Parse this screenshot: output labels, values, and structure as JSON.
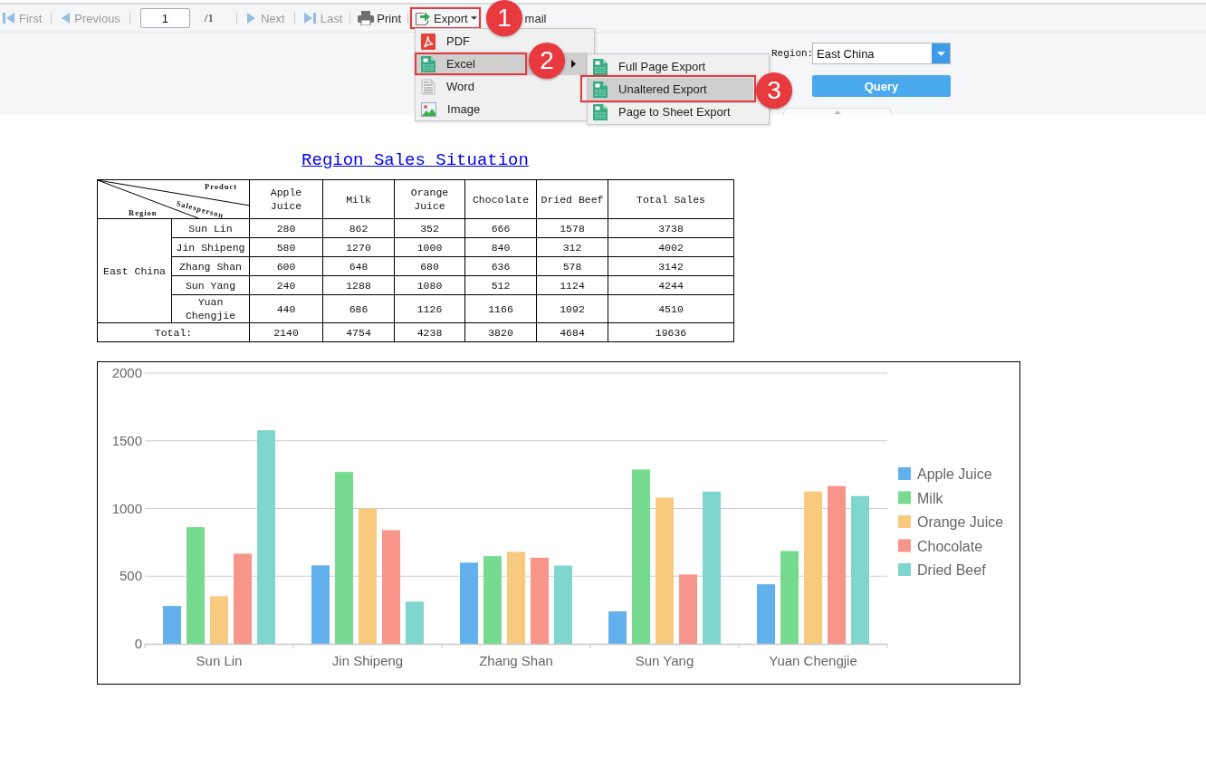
{
  "toolbar": {
    "items": [
      {
        "kind": "button",
        "label": "First",
        "disabled": true
      },
      {
        "kind": "button",
        "label": "Previous",
        "disabled": true
      },
      {
        "kind": "page",
        "value": "1",
        "total": "/1"
      },
      {
        "kind": "button",
        "label": "Next",
        "disabled": true
      },
      {
        "kind": "button",
        "label": "Last",
        "disabled": true
      },
      {
        "kind": "button",
        "label": "Print",
        "disabled": false
      },
      {
        "kind": "menu",
        "label": "Export",
        "disabled": false,
        "expanded": true,
        "callout": "1",
        "menu": {
          "items": [
            {
              "label": "PDF",
              "selected": false
            },
            {
              "label": "Excel",
              "selected": true,
              "callout": "2",
              "submenu": {
                "items": [
                  {
                    "label": "Full Page Export",
                    "selected": false
                  },
                  {
                    "label": "Unaltered Export",
                    "selected": true,
                    "callout": "3"
                  },
                  {
                    "label": "Page to Sheet Export",
                    "selected": false
                  }
                ]
              }
            },
            {
              "label": "Word",
              "selected": false
            },
            {
              "label": "Image",
              "selected": false
            }
          ]
        }
      },
      {
        "kind": "button",
        "label": "mail",
        "disabled": false
      }
    ]
  },
  "parameters": {
    "region": {
      "label": "Region:",
      "value": "East China"
    },
    "query_button": "Query"
  },
  "report": {
    "title": "Region Sales Situation",
    "table": {
      "corner_labels": {
        "top": "Product",
        "middle": "Salesperson",
        "bottom": "Region"
      },
      "columns": [
        "Apple Juice",
        "Milk",
        "Orange Juice",
        "Chocolate",
        "Dried Beef",
        "Total Sales"
      ],
      "region": "East China",
      "rows": [
        {
          "salesperson": "Sun Lin",
          "values": [
            "280",
            "862",
            "352",
            "666",
            "1578",
            "3738"
          ]
        },
        {
          "salesperson": "Jin Shipeng",
          "values": [
            "580",
            "1270",
            "1000",
            "840",
            "312",
            "4002"
          ]
        },
        {
          "salesperson": "Zhang Shan",
          "values": [
            "600",
            "648",
            "680",
            "636",
            "578",
            "3142"
          ]
        },
        {
          "salesperson": "Sun Yang",
          "values": [
            "240",
            "1288",
            "1080",
            "512",
            "1124",
            "4244"
          ]
        },
        {
          "salesperson": "Yuan Chengjie",
          "values": [
            "440",
            "686",
            "1126",
            "1166",
            "1092",
            "4510"
          ]
        }
      ],
      "total": {
        "label": "Total:",
        "values": [
          "2140",
          "4754",
          "4238",
          "3820",
          "4684",
          "19636"
        ]
      }
    },
    "chart": {
      "chart_data": {
        "type": "bar",
        "categories": [
          "Sun Lin",
          "Jin Shipeng",
          "Zhang Shan",
          "Sun Yang",
          "Yuan Chengjie"
        ],
        "series": [
          {
            "name": "Apple Juice",
            "color": "#62b0ec",
            "values": [
              280,
              580,
              600,
              240,
              440
            ]
          },
          {
            "name": "Milk",
            "color": "#76da8f",
            "values": [
              862,
              1270,
              648,
              1288,
              686
            ]
          },
          {
            "name": "Orange Juice",
            "color": "#f8ca7e",
            "values": [
              352,
              1000,
              680,
              1080,
              1126
            ]
          },
          {
            "name": "Chocolate",
            "color": "#f7958a",
            "values": [
              666,
              840,
              636,
              512,
              1166
            ]
          },
          {
            "name": "Dried Beef",
            "color": "#7fd6cf",
            "values": [
              1578,
              312,
              578,
              1124,
              1092
            ]
          }
        ],
        "ylim": [
          0,
          2000
        ],
        "yticks": [
          0,
          500,
          1000,
          1500,
          2000
        ],
        "grid": true,
        "legend": true
      }
    }
  }
}
